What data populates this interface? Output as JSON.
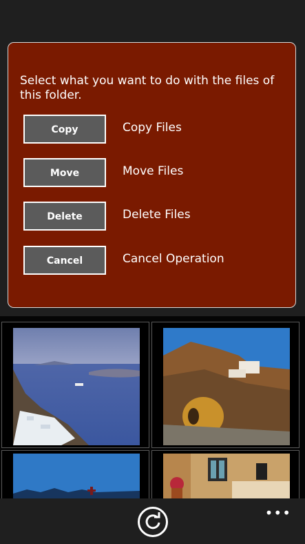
{
  "dialog": {
    "prompt": "Select what you want to do with the files of this folder.",
    "actions": [
      {
        "button": "Copy",
        "description": "Copy Files"
      },
      {
        "button": "Move",
        "description": "Move Files"
      },
      {
        "button": "Delete",
        "description": "Delete Files"
      },
      {
        "button": "Cancel",
        "description": "Cancel Operation"
      }
    ]
  },
  "appbar": {
    "refresh_icon": "refresh-icon",
    "more_label": "•••"
  },
  "colors": {
    "dialog_bg": "#7a1a00",
    "button_bg": "#5b5b5b",
    "page_bg": "#1f1f1f"
  }
}
